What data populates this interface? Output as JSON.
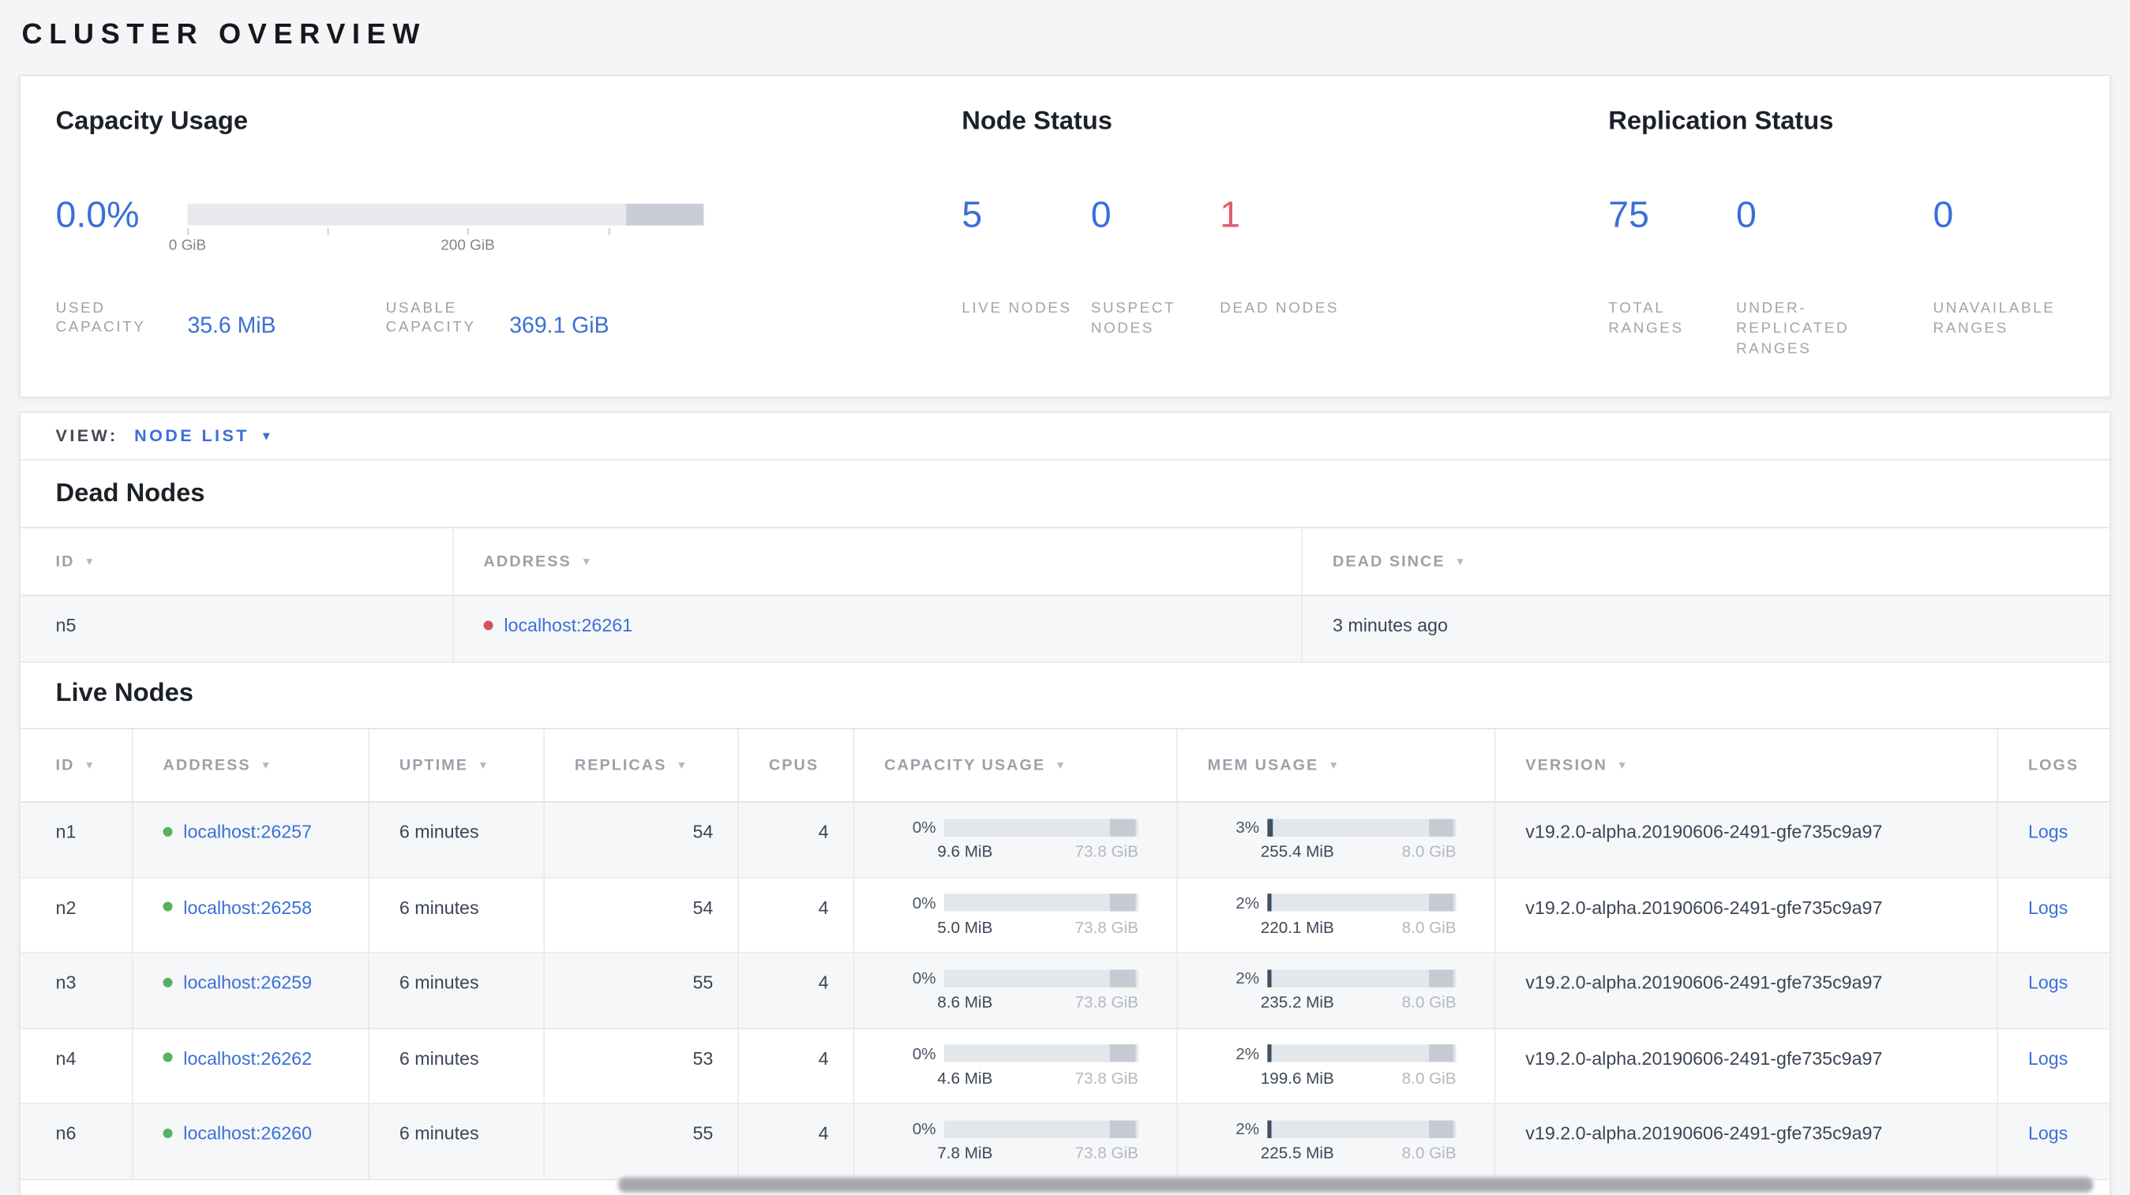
{
  "title": "CLUSTER OVERVIEW",
  "colors": {
    "accent_blue": "#3b6fd6",
    "danger_red": "#e05c6c",
    "live_green": "#54b261",
    "dead_red": "#d0545c",
    "bar_track": "#e7e9ec",
    "bar_reserved": "#c9ced6",
    "bar_used": "#3d5064"
  },
  "icons": {
    "sort_caret": "▼",
    "dropdown_caret": "▼"
  },
  "summary": {
    "capacity": {
      "title": "Capacity Usage",
      "percent": "0.0%",
      "tick_labels": [
        "0 GiB",
        "200 GiB"
      ],
      "used": {
        "label": "USED CAPACITY",
        "value": "35.6 MiB"
      },
      "usable": {
        "label": "USABLE CAPACITY",
        "value": "369.1 GiB"
      }
    },
    "node_status": {
      "title": "Node Status",
      "stats": [
        {
          "value": "5",
          "label": "LIVE NODES"
        },
        {
          "value": "0",
          "label": "SUSPECT NODES"
        },
        {
          "value": "1",
          "label": "DEAD NODES"
        }
      ]
    },
    "replication": {
      "title": "Replication Status",
      "stats": [
        {
          "value": "75",
          "label": "TOTAL RANGES"
        },
        {
          "value": "0",
          "label": "UNDER-REPLICATED RANGES"
        },
        {
          "value": "0",
          "label": "UNAVAILABLE RANGES"
        }
      ]
    }
  },
  "view_bar": {
    "label": "VIEW:",
    "selected": "NODE LIST"
  },
  "dead_nodes": {
    "title": "Dead Nodes",
    "columns": [
      "ID",
      "ADDRESS",
      "DEAD SINCE"
    ],
    "rows": [
      {
        "id": "n5",
        "address": "localhost:26261",
        "dead_since": "3 minutes ago"
      }
    ]
  },
  "live_nodes": {
    "title": "Live Nodes",
    "columns": [
      "ID",
      "ADDRESS",
      "UPTIME",
      "REPLICAS",
      "CPUS",
      "CAPACITY USAGE",
      "MEM USAGE",
      "VERSION",
      "LOGS"
    ],
    "rows": [
      {
        "id": "n1",
        "address": "localhost:26257",
        "uptime": "6 minutes",
        "replicas": "54",
        "cpus": "4",
        "capacity_pct": "0%",
        "capacity_pct_num": 0,
        "capacity_used": "9.6 MiB",
        "capacity_total": "73.8 GiB",
        "mem_pct": "3%",
        "mem_pct_num": 3,
        "mem_used": "255.4 MiB",
        "mem_total": "8.0 GiB",
        "version": "v19.2.0-alpha.20190606-2491-gfe735c9a97",
        "logs": "Logs"
      },
      {
        "id": "n2",
        "address": "localhost:26258",
        "uptime": "6 minutes",
        "replicas": "54",
        "cpus": "4",
        "capacity_pct": "0%",
        "capacity_pct_num": 0,
        "capacity_used": "5.0 MiB",
        "capacity_total": "73.8 GiB",
        "mem_pct": "2%",
        "mem_pct_num": 2,
        "mem_used": "220.1 MiB",
        "mem_total": "8.0 GiB",
        "version": "v19.2.0-alpha.20190606-2491-gfe735c9a97",
        "logs": "Logs"
      },
      {
        "id": "n3",
        "address": "localhost:26259",
        "uptime": "6 minutes",
        "replicas": "55",
        "cpus": "4",
        "capacity_pct": "0%",
        "capacity_pct_num": 0,
        "capacity_used": "8.6 MiB",
        "capacity_total": "73.8 GiB",
        "mem_pct": "2%",
        "mem_pct_num": 2,
        "mem_used": "235.2 MiB",
        "mem_total": "8.0 GiB",
        "version": "v19.2.0-alpha.20190606-2491-gfe735c9a97",
        "logs": "Logs"
      },
      {
        "id": "n4",
        "address": "localhost:26262",
        "uptime": "6 minutes",
        "replicas": "53",
        "cpus": "4",
        "capacity_pct": "0%",
        "capacity_pct_num": 0,
        "capacity_used": "4.6 MiB",
        "capacity_total": "73.8 GiB",
        "mem_pct": "2%",
        "mem_pct_num": 2,
        "mem_used": "199.6 MiB",
        "mem_total": "8.0 GiB",
        "version": "v19.2.0-alpha.20190606-2491-gfe735c9a97",
        "logs": "Logs"
      },
      {
        "id": "n6",
        "address": "localhost:26260",
        "uptime": "6 minutes",
        "replicas": "55",
        "cpus": "4",
        "capacity_pct": "0%",
        "capacity_pct_num": 0,
        "capacity_used": "7.8 MiB",
        "capacity_total": "73.8 GiB",
        "mem_pct": "2%",
        "mem_pct_num": 2,
        "mem_used": "225.5 MiB",
        "mem_total": "8.0 GiB",
        "version": "v19.2.0-alpha.20190606-2491-gfe735c9a97",
        "logs": "Logs"
      }
    ]
  }
}
